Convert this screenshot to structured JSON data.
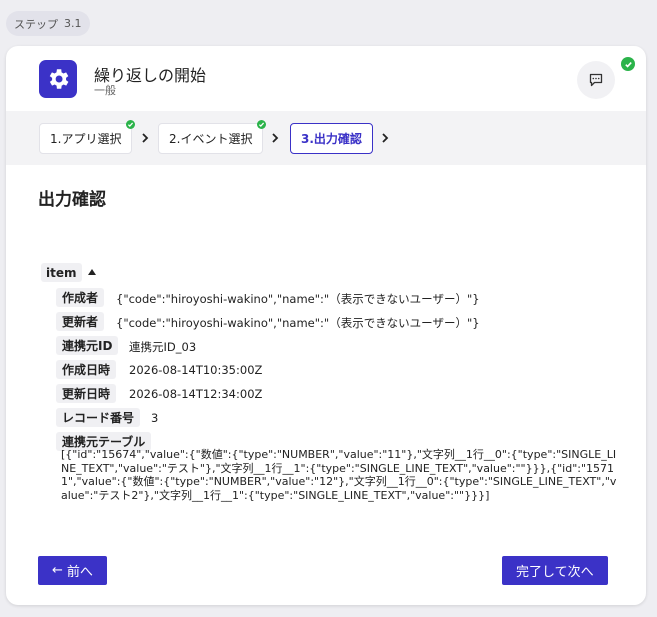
{
  "step_badge": {
    "label": "ステップ",
    "number": "3.1"
  },
  "header": {
    "icon": "gear-icon",
    "title": "繰り返しの開始",
    "subtitle": "一般",
    "comment_icon": "comment-icon"
  },
  "stepper": {
    "steps": [
      {
        "label": "1.アプリ選択",
        "done": true
      },
      {
        "label": "2.イベント選択",
        "done": true
      },
      {
        "label": "3.出力確認",
        "active": true
      }
    ]
  },
  "content": {
    "section_title": "出力確認",
    "item_label": "item",
    "fields": [
      {
        "key": "作成者",
        "value": "{\"code\":\"hiroyoshi-wakino\",\"name\":\"（表示できないユーザー）\"}"
      },
      {
        "key": "更新者",
        "value": "{\"code\":\"hiroyoshi-wakino\",\"name\":\"（表示できないユーザー）\"}"
      },
      {
        "key": "連携元ID",
        "value": "連携元ID_03"
      },
      {
        "key": "作成日時",
        "value": "2026-08-14T10:35:00Z"
      },
      {
        "key": "更新日時",
        "value": "2026-08-14T12:34:00Z"
      },
      {
        "key": "レコード番号",
        "value": "3"
      },
      {
        "key": "連携元テーブル",
        "value": "[{\"id\":\"15674\",\"value\":{\"数値\":{\"type\":\"NUMBER\",\"value\":\"11\"},\"文字列__1行__0\":{\"type\":\"SINGLE_LINE_TEXT\",\"value\":\"テスト\"},\"文字列__1行__1\":{\"type\":\"SINGLE_LINE_TEXT\",\"value\":\"\"}}},{\"id\":\"15711\",\"value\":{\"数値\":{\"type\":\"NUMBER\",\"value\":\"12\"},\"文字列__1行__0\":{\"type\":\"SINGLE_LINE_TEXT\",\"value\":\"テスト2\"},\"文字列__1行__1\":{\"type\":\"SINGLE_LINE_TEXT\",\"value\":\"\"}}}]"
      }
    ]
  },
  "footer": {
    "prev_label": "前へ",
    "next_label": "完了して次へ"
  },
  "colors": {
    "accent": "#3b32c7",
    "success": "#2bb34a"
  }
}
